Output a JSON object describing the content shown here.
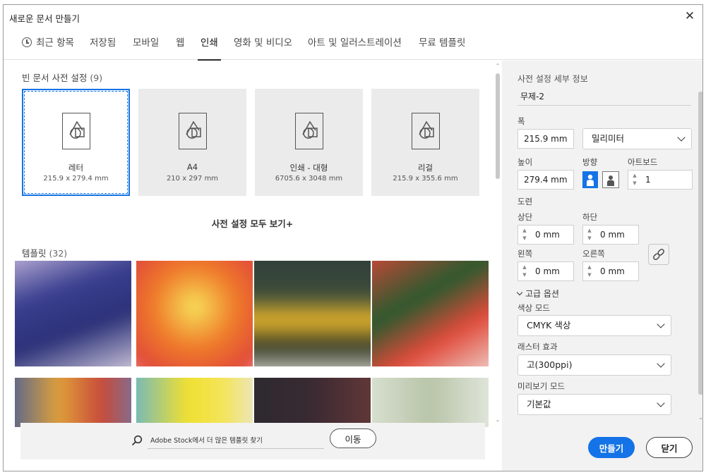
{
  "window": {
    "title": "새로운 문서 만들기"
  },
  "tabs": [
    {
      "label": "최근 항목"
    },
    {
      "label": "저장됨"
    },
    {
      "label": "모바일"
    },
    {
      "label": "웹"
    },
    {
      "label": "인쇄",
      "active": true
    },
    {
      "label": "영화 및 비디오"
    },
    {
      "label": "아트 및 일러스트레이션"
    },
    {
      "label": "무료 템플릿"
    }
  ],
  "presets_section": {
    "label": "빈 문서 사전 설정",
    "count": "(9)"
  },
  "presets": [
    {
      "name": "레터",
      "size": "215.9 x 279.4 mm",
      "selected": true
    },
    {
      "name": "A4",
      "size": "210 x 297 mm"
    },
    {
      "name": "인쇄 - 대형",
      "size": "6705.6 x 3048 mm"
    },
    {
      "name": "리걸",
      "size": "215.9 x 355.6 mm"
    }
  ],
  "see_all": "사전 설정 모두 보기+",
  "templates_section": {
    "label": "템플릿",
    "count": "(32)"
  },
  "stock": {
    "value": "Adobe Stock에서 더 많은 템플릿 찾기",
    "go_label": "이동"
  },
  "details": {
    "title": "사전 설정 세부 정보",
    "name": "무제-2",
    "width_label": "폭",
    "width_value": "215.9 mm",
    "unit": "밀리미터",
    "height_label": "높이",
    "height_value": "279.4 mm",
    "orientation_label": "방향",
    "orientation": "portrait",
    "artboards_label": "아트보드",
    "artboards_value": "1",
    "bleed_label": "도련",
    "bleed_top_label": "상단",
    "bleed_top": "0 mm",
    "bleed_bottom_label": "하단",
    "bleed_bottom": "0 mm",
    "bleed_left_label": "왼쪽",
    "bleed_left": "0 mm",
    "bleed_right_label": "오른쪽",
    "bleed_right": "0 mm",
    "advanced_label": "고급 옵션",
    "color_mode_label": "색상 모드",
    "color_mode": "CMYK 색상",
    "raster_label": "래스터 효과",
    "raster": "고(300ppi)",
    "preview_label": "미리보기 모드",
    "preview": "기본값"
  },
  "actions": {
    "create": "만들기",
    "close": "닫기"
  },
  "colors": {
    "accent": "#1473e6",
    "panel": "#f2f2f2",
    "tile": "#ebebeb"
  },
  "icons": [
    "clock-icon",
    "close-icon",
    "document-shapes-icon",
    "search-icon",
    "portrait-icon",
    "landscape-icon",
    "link-icon",
    "chevron-down-icon"
  ]
}
